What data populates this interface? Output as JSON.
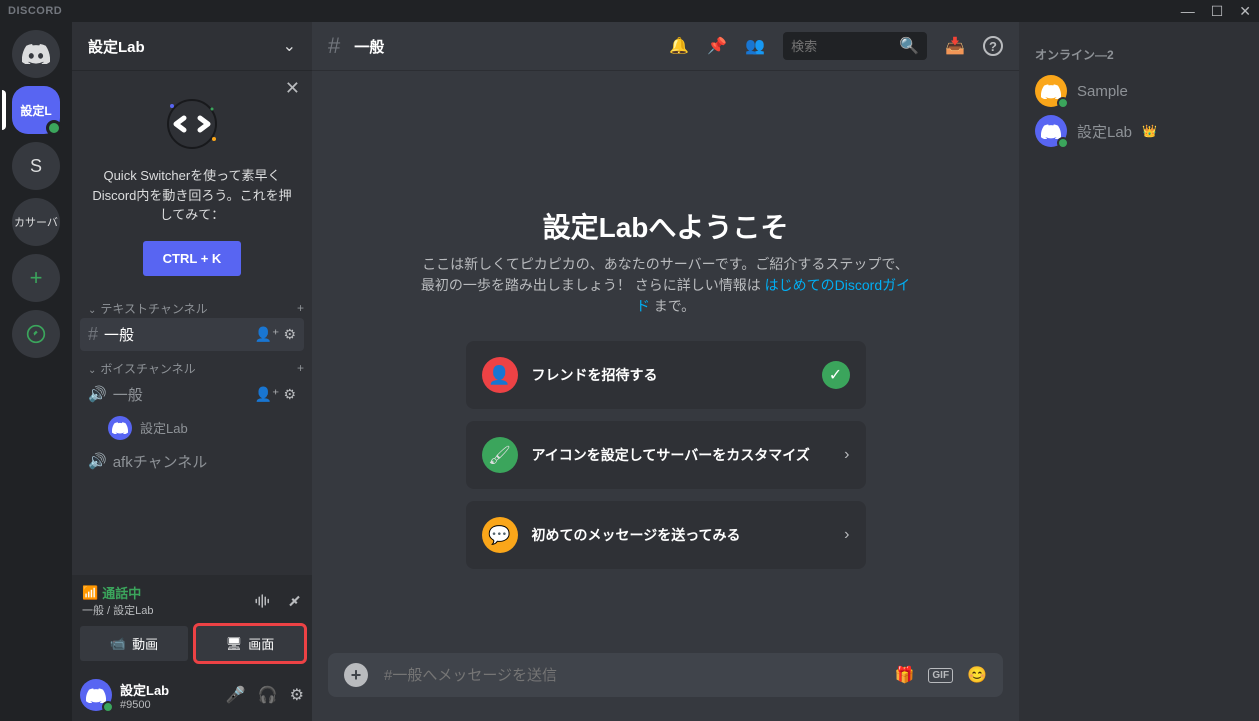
{
  "titlebar": {
    "text": "DISCORD"
  },
  "servers": {
    "active_label": "設定L",
    "s_label": "S",
    "find_label": "カサーバ"
  },
  "channels": {
    "server_name": "設定Lab",
    "qs_text": "Quick Switcherを使って素早くDiscord内を動き回ろう。これを押してみて：",
    "qs_button": "CTRL + K",
    "text_category": "テキストチャンネル",
    "text_general": "一般",
    "voice_category": "ボイスチャンネル",
    "voice_general": "一般",
    "voice_user": "設定Lab",
    "voice_afk": "afkチャンネル",
    "conn_status": "通話中",
    "conn_sub": "一般 / 設定Lab",
    "btn_video": "動画",
    "btn_screen": "画面",
    "username": "設定Lab",
    "usertag": "#9500"
  },
  "main": {
    "channel_name": "一般",
    "search_placeholder": "検索",
    "welcome_title": "設定Labへようこそ",
    "welcome_desc1": "ここは新しくてピカピカの、あなたのサーバーです。ご紹介するステップで、最初の一歩を踏み出しましょう！ さらに詳しい情報は ",
    "welcome_link": "はじめてのDiscordガイド",
    "welcome_desc2": " まで。",
    "onboard_invite": "フレンドを招待する",
    "onboard_icon": "アイコンを設定してサーバーをカスタマイズ",
    "onboard_message": "初めてのメッセージを送ってみる",
    "input_placeholder": "#一般へメッセージを送信"
  },
  "members": {
    "header": "オンライン—2",
    "sample": "Sample",
    "owner": "設定Lab"
  }
}
